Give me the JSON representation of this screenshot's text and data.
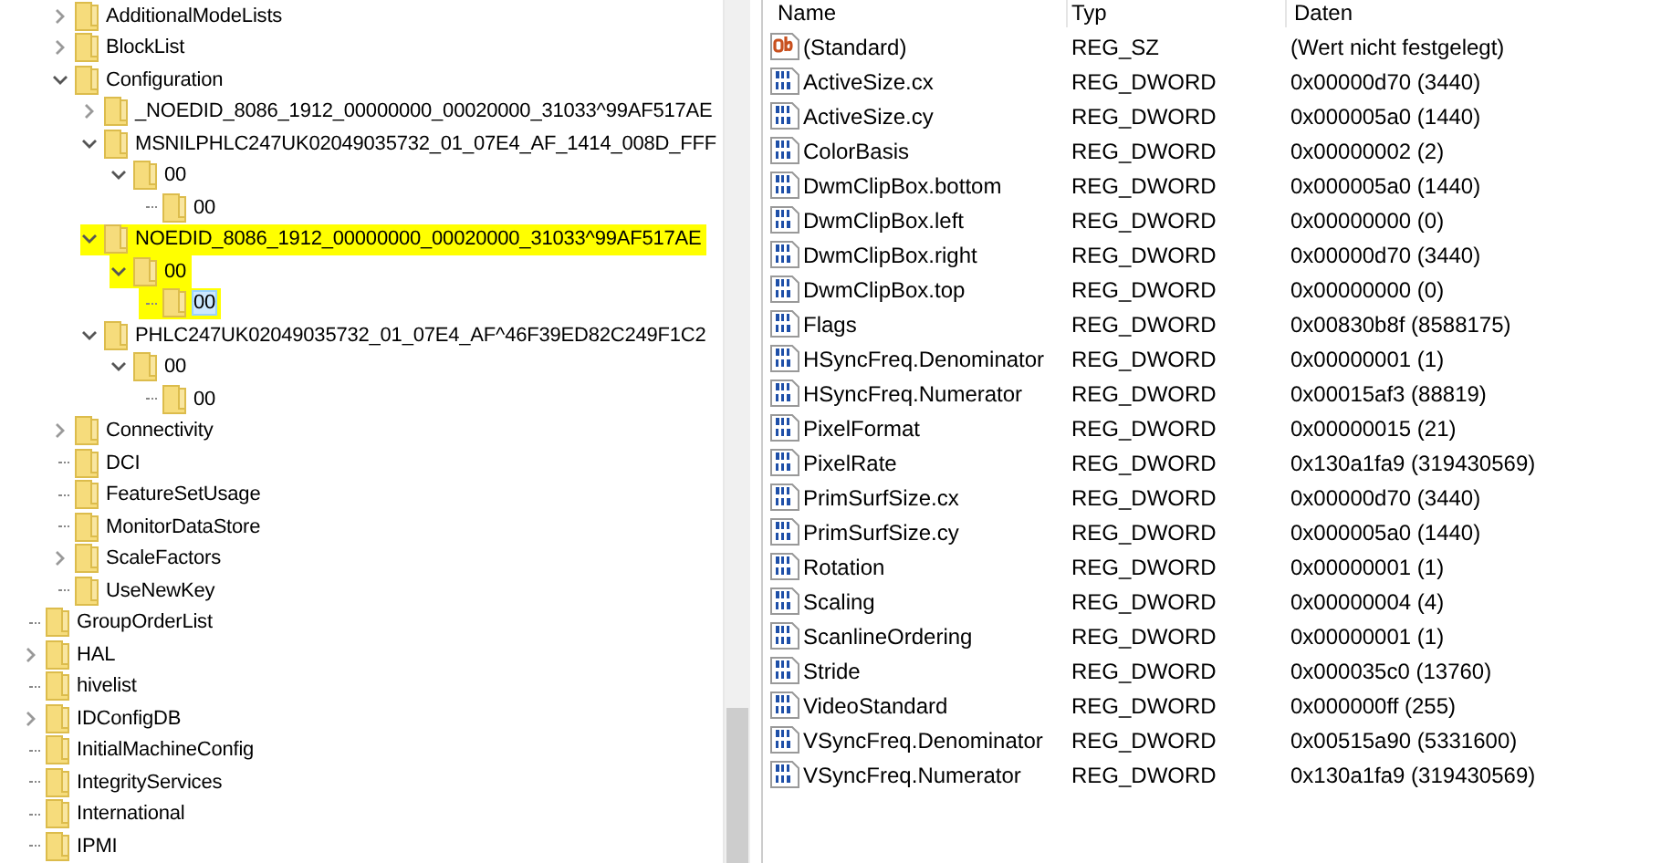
{
  "tree": {
    "continued_branch": [
      {
        "label": "AdditionalModeLists",
        "kind": "branch",
        "expanded": false,
        "selected": false,
        "highlighted": false
      },
      {
        "label": "BlockList",
        "kind": "branch",
        "expanded": false,
        "selected": false,
        "highlighted": false
      },
      {
        "label": "Configuration",
        "kind": "branch",
        "expanded": true,
        "selected": false,
        "highlighted": false,
        "children": [
          {
            "label": "_NOEDID_8086_1912_00000000_00020000_31033^99AF517AE",
            "kind": "branch",
            "expanded": false,
            "selected": false,
            "highlighted": false
          },
          {
            "label": "MSNILPHLC247UK02049035732_01_07E4_AF_1414_008D_FFF",
            "kind": "branch",
            "expanded": true,
            "selected": false,
            "highlighted": false,
            "children": [
              {
                "label": "00",
                "kind": "branch",
                "expanded": true,
                "selected": false,
                "highlighted": false,
                "children": [
                  {
                    "label": "00",
                    "kind": "leaf",
                    "selected": false,
                    "highlighted": false
                  }
                ]
              }
            ]
          },
          {
            "label": "NOEDID_8086_1912_00000000_00020000_31033^99AF517AE",
            "kind": "branch",
            "expanded": true,
            "selected": false,
            "highlighted": true,
            "children": [
              {
                "label": "00",
                "kind": "branch",
                "expanded": true,
                "selected": false,
                "highlighted": true,
                "children": [
                  {
                    "label": "00",
                    "kind": "leaf",
                    "selected": true,
                    "highlighted": true
                  }
                ]
              }
            ]
          },
          {
            "label": "PHLC247UK02049035732_01_07E4_AF^46F39ED82C249F1C2",
            "kind": "branch",
            "expanded": true,
            "selected": false,
            "highlighted": false,
            "children": [
              {
                "label": "00",
                "kind": "branch",
                "expanded": true,
                "selected": false,
                "highlighted": false,
                "children": [
                  {
                    "label": "00",
                    "kind": "leaf",
                    "selected": false,
                    "highlighted": false
                  }
                ]
              }
            ]
          }
        ]
      },
      {
        "label": "Connectivity",
        "kind": "branch",
        "expanded": false,
        "selected": false,
        "highlighted": false
      },
      {
        "label": "DCI",
        "kind": "leaf",
        "selected": false,
        "highlighted": false
      },
      {
        "label": "FeatureSetUsage",
        "kind": "leaf",
        "selected": false,
        "highlighted": false
      },
      {
        "label": "MonitorDataStore",
        "kind": "leaf",
        "selected": false,
        "highlighted": false
      },
      {
        "label": "ScaleFactors",
        "kind": "branch",
        "expanded": false,
        "selected": false,
        "highlighted": false
      },
      {
        "label": "UseNewKey",
        "kind": "leaf",
        "selected": false,
        "highlighted": false
      }
    ],
    "items": [
      {
        "label": "GroupOrderList",
        "kind": "leaf",
        "selected": false,
        "highlighted": false
      },
      {
        "label": "HAL",
        "kind": "branch",
        "expanded": false,
        "selected": false,
        "highlighted": false
      },
      {
        "label": "hivelist",
        "kind": "leaf",
        "selected": false,
        "highlighted": false
      },
      {
        "label": "IDConfigDB",
        "kind": "branch",
        "expanded": false,
        "selected": false,
        "highlighted": false
      },
      {
        "label": "InitialMachineConfig",
        "kind": "leaf",
        "selected": false,
        "highlighted": false
      },
      {
        "label": "IntegrityServices",
        "kind": "leaf",
        "selected": false,
        "highlighted": false
      },
      {
        "label": "International",
        "kind": "leaf",
        "selected": false,
        "highlighted": false
      },
      {
        "label": "IPMI",
        "kind": "leaf",
        "selected": false,
        "highlighted": false
      }
    ]
  },
  "values": {
    "columns": [
      "Name",
      "Typ",
      "Daten"
    ],
    "rows": [
      {
        "kind": "string",
        "name": "(Standard)",
        "type": "REG_SZ",
        "data": "(Wert nicht festgelegt)"
      },
      {
        "kind": "dword",
        "name": "ActiveSize.cx",
        "type": "REG_DWORD",
        "data": "0x00000d70 (3440)"
      },
      {
        "kind": "dword",
        "name": "ActiveSize.cy",
        "type": "REG_DWORD",
        "data": "0x000005a0 (1440)"
      },
      {
        "kind": "dword",
        "name": "ColorBasis",
        "type": "REG_DWORD",
        "data": "0x00000002 (2)"
      },
      {
        "kind": "dword",
        "name": "DwmClipBox.bottom",
        "type": "REG_DWORD",
        "data": "0x000005a0 (1440)"
      },
      {
        "kind": "dword",
        "name": "DwmClipBox.left",
        "type": "REG_DWORD",
        "data": "0x00000000 (0)"
      },
      {
        "kind": "dword",
        "name": "DwmClipBox.right",
        "type": "REG_DWORD",
        "data": "0x00000d70 (3440)"
      },
      {
        "kind": "dword",
        "name": "DwmClipBox.top",
        "type": "REG_DWORD",
        "data": "0x00000000 (0)"
      },
      {
        "kind": "dword",
        "name": "Flags",
        "type": "REG_DWORD",
        "data": "0x00830b8f (8588175)"
      },
      {
        "kind": "dword",
        "name": "HSyncFreq.Denominator",
        "type": "REG_DWORD",
        "data": "0x00000001 (1)"
      },
      {
        "kind": "dword",
        "name": "HSyncFreq.Numerator",
        "type": "REG_DWORD",
        "data": "0x00015af3 (88819)"
      },
      {
        "kind": "dword",
        "name": "PixelFormat",
        "type": "REG_DWORD",
        "data": "0x00000015 (21)"
      },
      {
        "kind": "dword",
        "name": "PixelRate",
        "type": "REG_DWORD",
        "data": "0x130a1fa9 (319430569)"
      },
      {
        "kind": "dword",
        "name": "PrimSurfSize.cx",
        "type": "REG_DWORD",
        "data": "0x00000d70 (3440)"
      },
      {
        "kind": "dword",
        "name": "PrimSurfSize.cy",
        "type": "REG_DWORD",
        "data": "0x000005a0 (1440)"
      },
      {
        "kind": "dword",
        "name": "Rotation",
        "type": "REG_DWORD",
        "data": "0x00000001 (1)"
      },
      {
        "kind": "dword",
        "name": "Scaling",
        "type": "REG_DWORD",
        "data": "0x00000004 (4)"
      },
      {
        "kind": "dword",
        "name": "ScanlineOrdering",
        "type": "REG_DWORD",
        "data": "0x00000001 (1)"
      },
      {
        "kind": "dword",
        "name": "Stride",
        "type": "REG_DWORD",
        "data": "0x000035c0 (13760)"
      },
      {
        "kind": "dword",
        "name": "VideoStandard",
        "type": "REG_DWORD",
        "data": "0x000000ff (255)"
      },
      {
        "kind": "dword",
        "name": "VSyncFreq.Denominator",
        "type": "REG_DWORD",
        "data": "0x00515a90 (5331600)"
      },
      {
        "kind": "dword",
        "name": "VSyncFreq.Numerator",
        "type": "REG_DWORD",
        "data": "0x130a1fa9 (319430569)"
      }
    ]
  }
}
